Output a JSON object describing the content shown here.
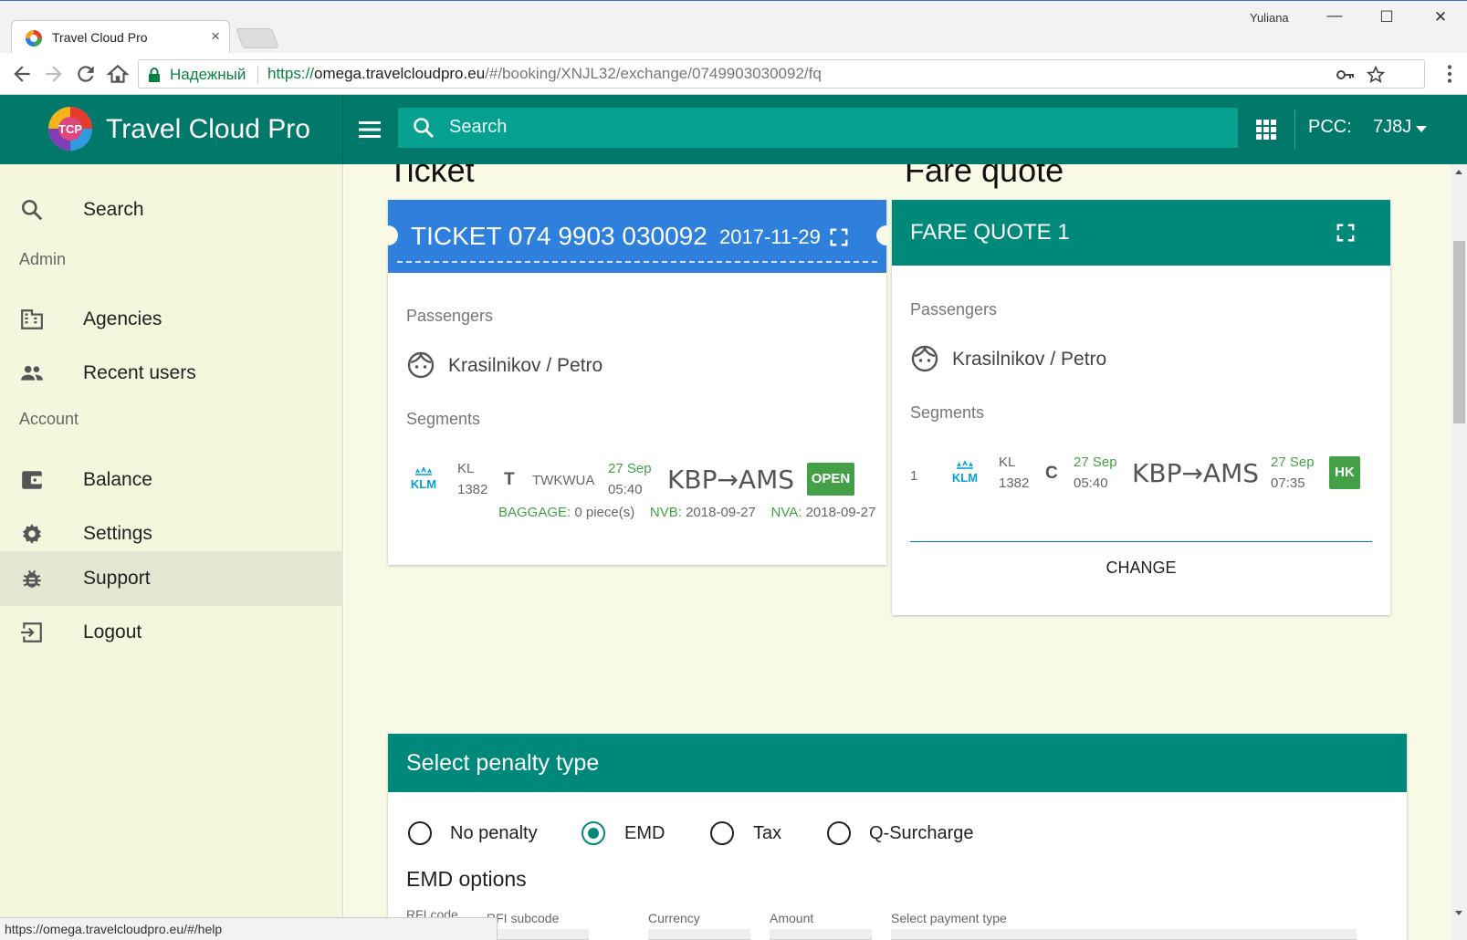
{
  "browser": {
    "tab_title": "Travel Cloud Pro",
    "tab_close": "×",
    "window_user": "Yuliana",
    "secure_label": "Надежный",
    "url_scheme": "https://",
    "url_host": "omega.travelcloudpro.eu",
    "url_path": "/#/booking/XNJL32/exchange/0749903030092/fq",
    "status_url": "https://omega.travelcloudpro.eu/#/help"
  },
  "header": {
    "brand": "Travel Cloud Pro",
    "logo_text": "TCP",
    "search_placeholder": "Search",
    "pcc_label": "PCC:",
    "pcc_value": "7J8J",
    "colors": {
      "primary": "#00796b",
      "search_bg": "#06a191"
    }
  },
  "sidebar": {
    "search": "Search",
    "admin_section": "Admin",
    "agencies": "Agencies",
    "recent_users": "Recent users",
    "account_section": "Account",
    "balance": "Balance",
    "settings": "Settings",
    "support": "Support",
    "logout": "Logout",
    "active_item": "Support"
  },
  "ticket_section": {
    "heading": "Ticket",
    "card_title": "TICKET  074 9903 030092",
    "date": "2017-11-29",
    "passengers_label": "Passengers",
    "passenger": "Krasilnikov / Petro",
    "segments_label": "Segments",
    "segment": {
      "airline_logo": "KLM",
      "carrier": "KL",
      "flight": "1382",
      "class": "T",
      "fare_basis": "TWKWUA",
      "dep_date": "27 Sep",
      "dep_time": "05:40",
      "route": "KBP→AMS",
      "status": "OPEN",
      "baggage_label": "BAGGAGE:",
      "baggage_value": "0 piece(s)",
      "nvb_label": "NVB:",
      "nvb_value": "2018-09-27",
      "nva_label": "NVA:",
      "nva_value": "2018-09-27"
    }
  },
  "fare_section": {
    "heading": "Fare quote",
    "card_title": "FARE QUOTE 1",
    "passengers_label": "Passengers",
    "passenger": "Krasilnikov / Petro",
    "segments_label": "Segments",
    "segment": {
      "index": "1",
      "airline_logo": "KLM",
      "carrier": "KL",
      "flight": "1382",
      "class": "C",
      "dep_date": "27 Sep",
      "dep_time": "05:40",
      "route": "KBP→AMS",
      "arr_date": "27 Sep",
      "arr_time": "07:35",
      "status": "HK"
    },
    "change_button": "CHANGE"
  },
  "penalty": {
    "title": "Select penalty type",
    "options": [
      "No penalty",
      "EMD",
      "Tax",
      "Q-Surcharge"
    ],
    "selected": "EMD",
    "emd_options_label": "EMD options",
    "fields": {
      "rfic": "RFI code",
      "rfi_subcode": "RFI subcode",
      "currency": "Currency",
      "amount": "Amount",
      "payment_type": "Select payment type"
    }
  }
}
